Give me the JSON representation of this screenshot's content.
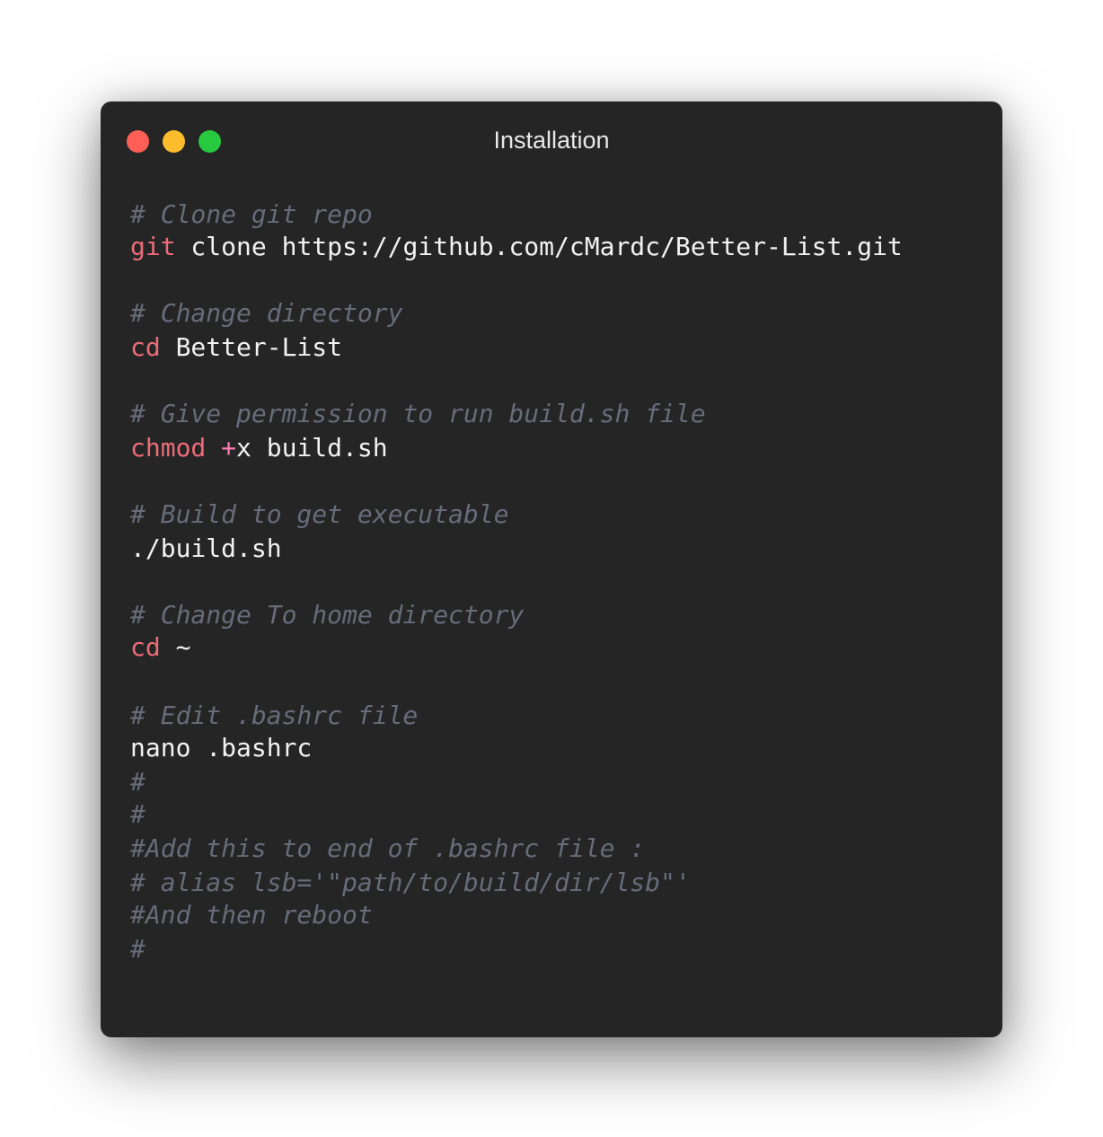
{
  "window": {
    "title": "Installation"
  },
  "code": {
    "comment_clone": "# Clone git repo",
    "clone_cmd": "git",
    "clone_args": " clone https://github.com/cMardc/Better-List.git",
    "comment_cd": "# Change directory",
    "cd_cmd": "cd",
    "cd_args": " Better-List",
    "comment_perm": "# Give permission to run build.sh file",
    "chmod_cmd": "chmod",
    "chmod_space": " ",
    "chmod_plus": "+",
    "chmod_args": "x build.sh",
    "comment_build": "# Build to get executable",
    "build_cmd": "./build.sh",
    "comment_home": "# Change To home directory",
    "home_cmd": "cd",
    "home_args": " ~",
    "comment_edit": "# Edit .bashrc file",
    "nano_cmd": "nano .bashrc",
    "hash1": "#",
    "hash2": "#",
    "comment_add": "#Add this to end of .bashrc file :",
    "comment_alias": "# alias lsb='\"path/to/build/dir/lsb\"'",
    "comment_reboot": "#And then reboot",
    "hash3": "#"
  },
  "colors": {
    "window_bg": "#252525",
    "comment": "#676c7a",
    "command": "#ec6c78",
    "operator": "#ff7ab8",
    "text": "#f2f2f2",
    "close": "#ff5f56",
    "minimize": "#ffbd2e",
    "maximize": "#27c93f"
  }
}
